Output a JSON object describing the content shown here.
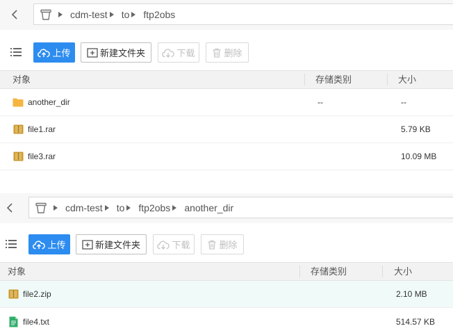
{
  "colors": {
    "accent": "#2d8cf0",
    "folder": "#f5b53f",
    "archive": "#c8962e",
    "text_file": "#2fae69",
    "row_highlight": "#f0faf8"
  },
  "panels": [
    {
      "path": [
        "cdm-test",
        "to",
        "ftp2obs"
      ],
      "toolbar": {
        "upload": "上传",
        "new_folder": "新建文件夹",
        "download": "下载",
        "delete": "删除"
      },
      "columns": {
        "name": "对象",
        "storage": "存储类别",
        "size": "大小"
      },
      "rows": [
        {
          "name": "another_dir",
          "icon": "folder-icon",
          "storage": "--",
          "size": "--",
          "highlight": false
        },
        {
          "name": "file1.rar",
          "icon": "archive-icon",
          "storage": "",
          "size": "5.79 KB",
          "highlight": false
        },
        {
          "name": "file3.rar",
          "icon": "archive-icon",
          "storage": "",
          "size": "10.09 MB",
          "highlight": false
        }
      ]
    },
    {
      "path": [
        "cdm-test",
        "to",
        "ftp2obs",
        "another_dir"
      ],
      "toolbar": {
        "upload": "上传",
        "new_folder": "新建文件夹",
        "download": "下载",
        "delete": "删除"
      },
      "columns": {
        "name": "对象",
        "storage": "存储类别",
        "size": "大小"
      },
      "rows": [
        {
          "name": "file2.zip",
          "icon": "archive-icon",
          "storage": "",
          "size": "2.10 MB",
          "highlight": true
        },
        {
          "name": "file4.txt",
          "icon": "text-file-icon",
          "storage": "",
          "size": "514.57 KB",
          "highlight": false
        }
      ]
    }
  ]
}
